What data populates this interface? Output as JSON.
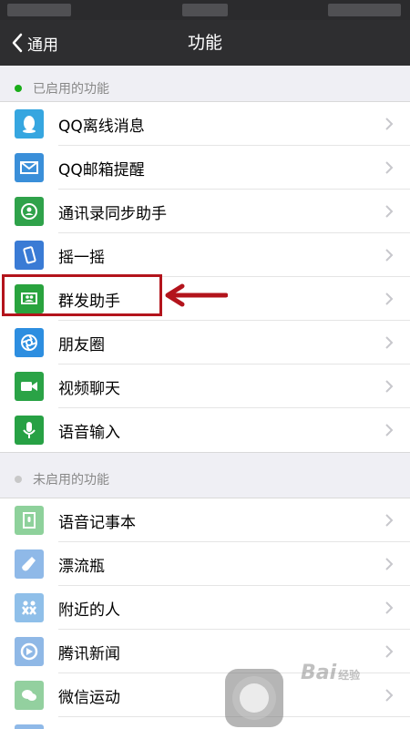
{
  "nav": {
    "back_label": "通用",
    "title": "功能"
  },
  "enabled_section": {
    "title": "已启用的功能",
    "dot_color": "#1aad19"
  },
  "enabled_items": [
    {
      "label": "QQ离线消息",
      "icon": "qq-penguin-icon",
      "color": "#36a6e0"
    },
    {
      "label": "QQ邮箱提醒",
      "icon": "mail-icon",
      "color": "#3a8fd9"
    },
    {
      "label": "通讯录同步助手",
      "icon": "contact-sync-icon",
      "color": "#2fa24a"
    },
    {
      "label": "摇一摇",
      "icon": "shake-phone-icon",
      "color": "#3a7bd5"
    },
    {
      "label": "群发助手",
      "icon": "group-message-icon",
      "color": "#29a33e"
    },
    {
      "label": "朋友圈",
      "icon": "moments-aperture-icon",
      "color": "#2d8ee0"
    },
    {
      "label": "视频聊天",
      "icon": "video-camera-icon",
      "color": "#2aa346"
    },
    {
      "label": "语音输入",
      "icon": "microphone-icon",
      "color": "#27a144"
    }
  ],
  "disabled_section": {
    "title": "未启用的功能",
    "dot_color": "#c8c8c8"
  },
  "disabled_items": [
    {
      "label": "语音记事本",
      "icon": "voice-notepad-icon",
      "color": "#8ed19b"
    },
    {
      "label": "漂流瓶",
      "icon": "drift-bottle-icon",
      "color": "#8fb9e8"
    },
    {
      "label": "附近的人",
      "icon": "people-nearby-icon",
      "color": "#8fbfe9"
    },
    {
      "label": "腾讯新闻",
      "icon": "tencent-news-icon",
      "color": "#8fb8e6"
    },
    {
      "label": "微信运动",
      "icon": "wechat-sport-icon",
      "color": "#93d09f"
    }
  ],
  "highlight_color": "#b3141c",
  "watermark": {
    "text": "Bai",
    "sub": "经验"
  }
}
